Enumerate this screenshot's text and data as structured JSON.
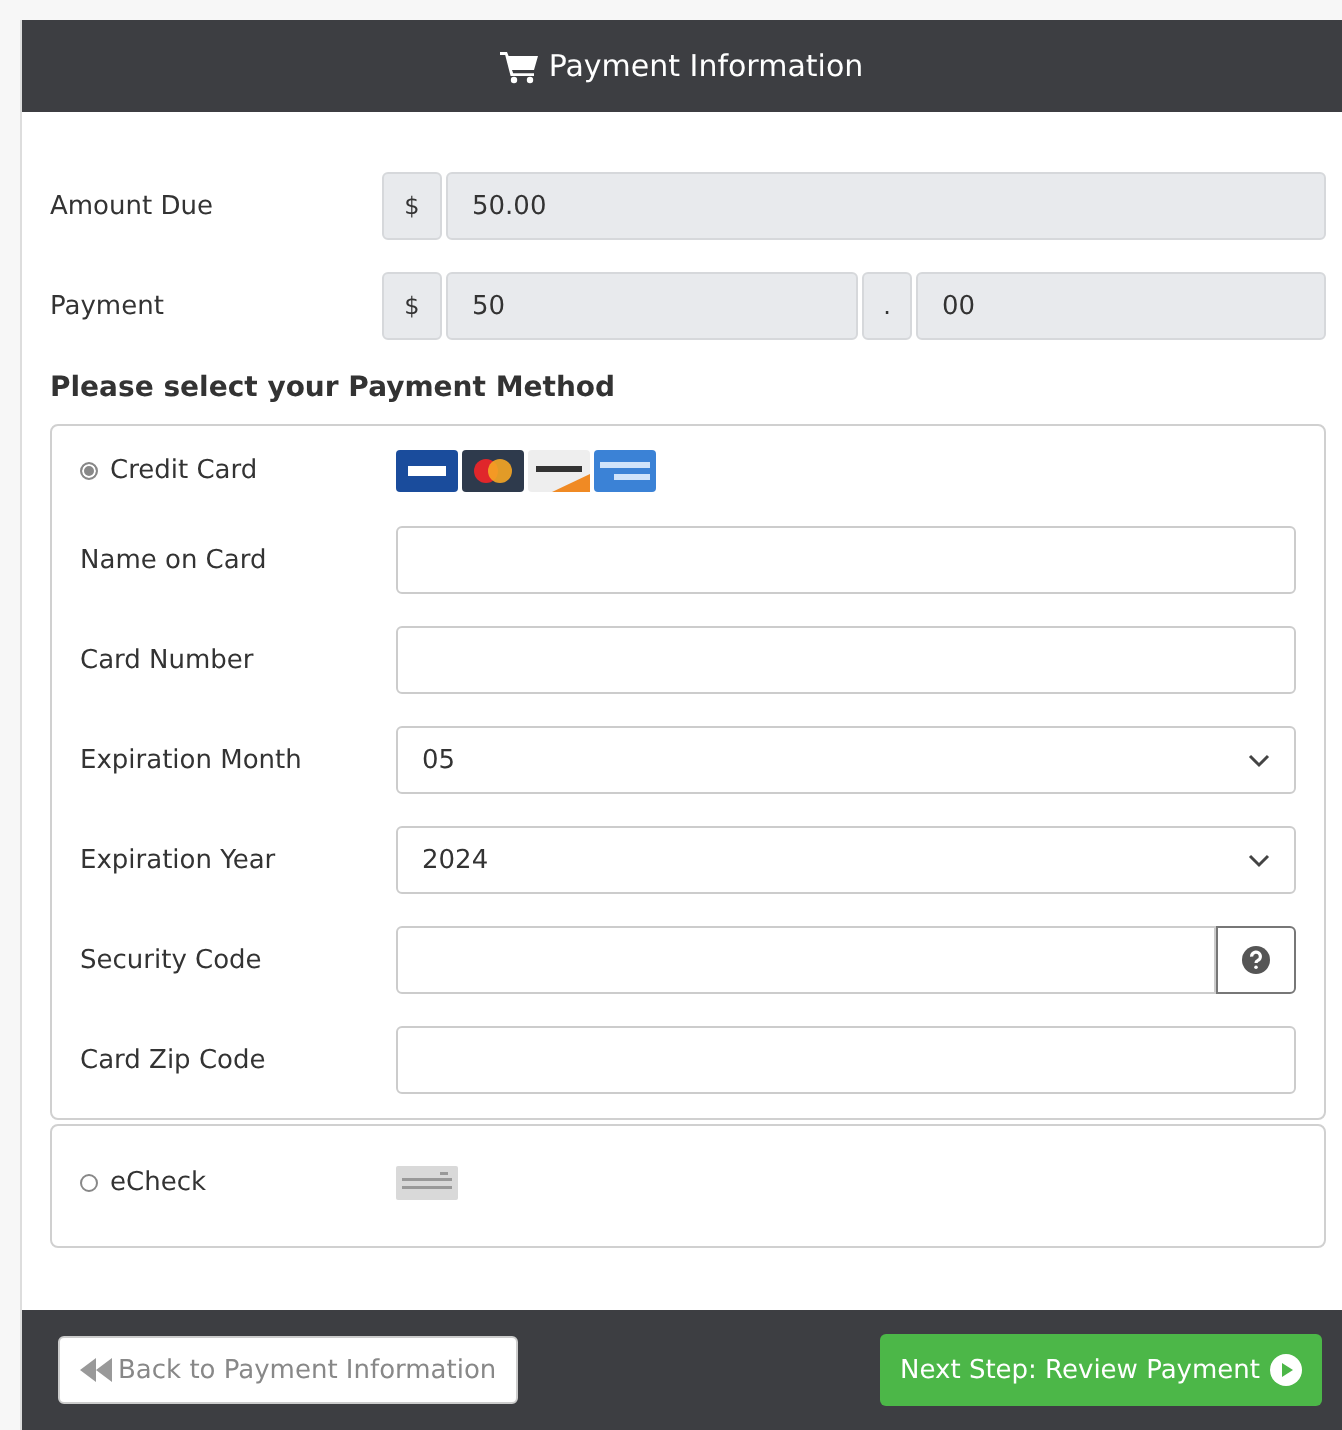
{
  "header": {
    "title": "Payment Information"
  },
  "amount_due": {
    "label": "Amount Due",
    "prefix": "$",
    "value": "50.00"
  },
  "payment": {
    "label": "Payment",
    "prefix": "$",
    "dollars": "50",
    "separator": ".",
    "cents": "00"
  },
  "method_heading": "Please select your Payment Method",
  "methods": [
    {
      "kind": "card",
      "label": "Credit Card",
      "selected": true,
      "fields": [
        {
          "kind": "text",
          "label": "Name on Card"
        },
        {
          "kind": "text",
          "label": "Card Number"
        },
        {
          "kind": "select",
          "label": "Expiration Month",
          "value": "05"
        },
        {
          "kind": "select",
          "label": "Expiration Year",
          "value": "2024"
        },
        {
          "kind": "help",
          "label": "Security Code"
        },
        {
          "kind": "text",
          "label": "Card Zip Code"
        }
      ]
    },
    {
      "kind": "echeck",
      "label": "eCheck",
      "selected": false
    }
  ],
  "buttons": {
    "back": "Back to Payment Information",
    "next": "Next Step: Review Payment"
  }
}
